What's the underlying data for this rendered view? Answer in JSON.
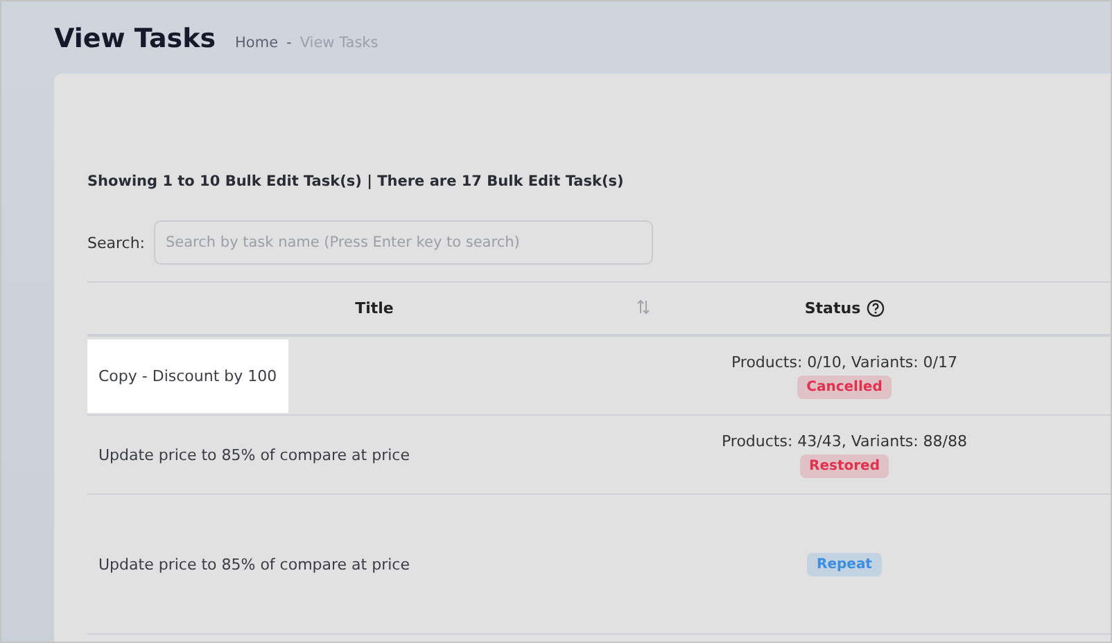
{
  "page": {
    "title": "View Tasks",
    "breadcrumb": [
      {
        "label": "Home",
        "current": false
      },
      {
        "label": "View Tasks",
        "current": true
      }
    ],
    "separator": "-"
  },
  "summary": "Showing 1 to 10 Bulk Edit Task(s) | There are 17 Bulk Edit Task(s)",
  "search": {
    "label": "Search:",
    "placeholder": "Search by task name (Press Enter key to search)"
  },
  "table": {
    "columns": [
      {
        "label": "Title",
        "sortable": true,
        "help": false
      },
      {
        "label": "Status",
        "sortable": false,
        "help": true
      }
    ],
    "rows": [
      {
        "title": "Copy - Discount by 100",
        "highlighted": true,
        "progress": "Products: 0/10, Variants: 0/17",
        "status": {
          "label": "Cancelled",
          "color": "#e0324e"
        }
      },
      {
        "title": "Update price to 85% of compare at price",
        "highlighted": false,
        "progress": "Products: 43/43, Variants: 88/88",
        "status": {
          "label": "Restored",
          "color": "#e0324e"
        }
      },
      {
        "title": "Update price to 85% of compare at price",
        "highlighted": false,
        "status": {
          "label": "Repeat",
          "color": "#3b8ee0"
        }
      }
    ]
  }
}
